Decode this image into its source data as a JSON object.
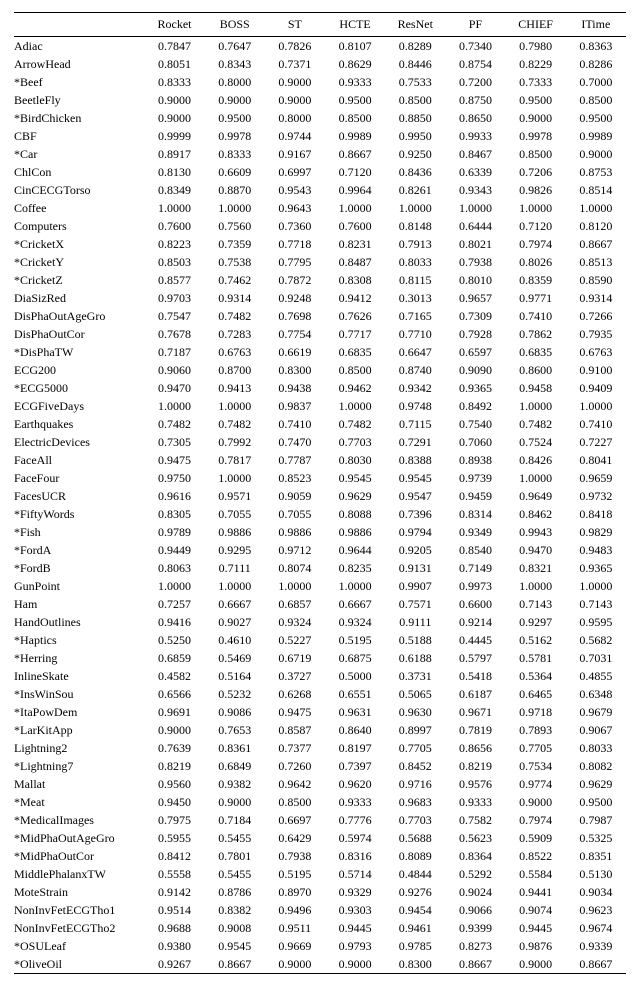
{
  "chart_data": {
    "type": "table",
    "columns": [
      "Rocket",
      "BOSS",
      "ST",
      "HCTE",
      "ResNet",
      "PF",
      "CHIEF",
      "ITime"
    ],
    "rows": [
      {
        "name": "Adiac",
        "v": [
          "0.7847",
          "0.7647",
          "0.7826",
          "0.8107",
          "0.8289",
          "0.7340",
          "0.7980",
          "0.8363"
        ]
      },
      {
        "name": "ArrowHead",
        "v": [
          "0.8051",
          "0.8343",
          "0.7371",
          "0.8629",
          "0.8446",
          "0.8754",
          "0.8229",
          "0.8286"
        ]
      },
      {
        "name": "*Beef",
        "v": [
          "0.8333",
          "0.8000",
          "0.9000",
          "0.9333",
          "0.7533",
          "0.7200",
          "0.7333",
          "0.7000"
        ]
      },
      {
        "name": "BeetleFly",
        "v": [
          "0.9000",
          "0.9000",
          "0.9000",
          "0.9500",
          "0.8500",
          "0.8750",
          "0.9500",
          "0.8500"
        ]
      },
      {
        "name": "*BirdChicken",
        "v": [
          "0.9000",
          "0.9500",
          "0.8000",
          "0.8500",
          "0.8850",
          "0.8650",
          "0.9000",
          "0.9500"
        ]
      },
      {
        "name": "CBF",
        "v": [
          "0.9999",
          "0.9978",
          "0.9744",
          "0.9989",
          "0.9950",
          "0.9933",
          "0.9978",
          "0.9989"
        ]
      },
      {
        "name": "*Car",
        "v": [
          "0.8917",
          "0.8333",
          "0.9167",
          "0.8667",
          "0.9250",
          "0.8467",
          "0.8500",
          "0.9000"
        ]
      },
      {
        "name": "ChlCon",
        "v": [
          "0.8130",
          "0.6609",
          "0.6997",
          "0.7120",
          "0.8436",
          "0.6339",
          "0.7206",
          "0.8753"
        ]
      },
      {
        "name": "CinCECGTorso",
        "v": [
          "0.8349",
          "0.8870",
          "0.9543",
          "0.9964",
          "0.8261",
          "0.9343",
          "0.9826",
          "0.8514"
        ]
      },
      {
        "name": "Coffee",
        "v": [
          "1.0000",
          "1.0000",
          "0.9643",
          "1.0000",
          "1.0000",
          "1.0000",
          "1.0000",
          "1.0000"
        ]
      },
      {
        "name": "Computers",
        "v": [
          "0.7600",
          "0.7560",
          "0.7360",
          "0.7600",
          "0.8148",
          "0.6444",
          "0.7120",
          "0.8120"
        ]
      },
      {
        "name": "*CricketX",
        "v": [
          "0.8223",
          "0.7359",
          "0.7718",
          "0.8231",
          "0.7913",
          "0.8021",
          "0.7974",
          "0.8667"
        ]
      },
      {
        "name": "*CricketY",
        "v": [
          "0.8503",
          "0.7538",
          "0.7795",
          "0.8487",
          "0.8033",
          "0.7938",
          "0.8026",
          "0.8513"
        ]
      },
      {
        "name": "*CricketZ",
        "v": [
          "0.8577",
          "0.7462",
          "0.7872",
          "0.8308",
          "0.8115",
          "0.8010",
          "0.8359",
          "0.8590"
        ]
      },
      {
        "name": "DiaSizRed",
        "v": [
          "0.9703",
          "0.9314",
          "0.9248",
          "0.9412",
          "0.3013",
          "0.9657",
          "0.9771",
          "0.9314"
        ]
      },
      {
        "name": "DisPhaOutAgeGro",
        "v": [
          "0.7547",
          "0.7482",
          "0.7698",
          "0.7626",
          "0.7165",
          "0.7309",
          "0.7410",
          "0.7266"
        ]
      },
      {
        "name": "DisPhaOutCor",
        "v": [
          "0.7678",
          "0.7283",
          "0.7754",
          "0.7717",
          "0.7710",
          "0.7928",
          "0.7862",
          "0.7935"
        ]
      },
      {
        "name": "*DisPhaTW",
        "v": [
          "0.7187",
          "0.6763",
          "0.6619",
          "0.6835",
          "0.6647",
          "0.6597",
          "0.6835",
          "0.6763"
        ]
      },
      {
        "name": "ECG200",
        "v": [
          "0.9060",
          "0.8700",
          "0.8300",
          "0.8500",
          "0.8740",
          "0.9090",
          "0.8600",
          "0.9100"
        ]
      },
      {
        "name": "*ECG5000",
        "v": [
          "0.9470",
          "0.9413",
          "0.9438",
          "0.9462",
          "0.9342",
          "0.9365",
          "0.9458",
          "0.9409"
        ]
      },
      {
        "name": "ECGFiveDays",
        "v": [
          "1.0000",
          "1.0000",
          "0.9837",
          "1.0000",
          "0.9748",
          "0.8492",
          "1.0000",
          "1.0000"
        ]
      },
      {
        "name": "Earthquakes",
        "v": [
          "0.7482",
          "0.7482",
          "0.7410",
          "0.7482",
          "0.7115",
          "0.7540",
          "0.7482",
          "0.7410"
        ]
      },
      {
        "name": "ElectricDevices",
        "v": [
          "0.7305",
          "0.7992",
          "0.7470",
          "0.7703",
          "0.7291",
          "0.7060",
          "0.7524",
          "0.7227"
        ]
      },
      {
        "name": "FaceAll",
        "v": [
          "0.9475",
          "0.7817",
          "0.7787",
          "0.8030",
          "0.8388",
          "0.8938",
          "0.8426",
          "0.8041"
        ]
      },
      {
        "name": "FaceFour",
        "v": [
          "0.9750",
          "1.0000",
          "0.8523",
          "0.9545",
          "0.9545",
          "0.9739",
          "1.0000",
          "0.9659"
        ]
      },
      {
        "name": "FacesUCR",
        "v": [
          "0.9616",
          "0.9571",
          "0.9059",
          "0.9629",
          "0.9547",
          "0.9459",
          "0.9649",
          "0.9732"
        ]
      },
      {
        "name": "*FiftyWords",
        "v": [
          "0.8305",
          "0.7055",
          "0.7055",
          "0.8088",
          "0.7396",
          "0.8314",
          "0.8462",
          "0.8418"
        ]
      },
      {
        "name": "*Fish",
        "v": [
          "0.9789",
          "0.9886",
          "0.9886",
          "0.9886",
          "0.9794",
          "0.9349",
          "0.9943",
          "0.9829"
        ]
      },
      {
        "name": "*FordA",
        "v": [
          "0.9449",
          "0.9295",
          "0.9712",
          "0.9644",
          "0.9205",
          "0.8540",
          "0.9470",
          "0.9483"
        ]
      },
      {
        "name": "*FordB",
        "v": [
          "0.8063",
          "0.7111",
          "0.8074",
          "0.8235",
          "0.9131",
          "0.7149",
          "0.8321",
          "0.9365"
        ]
      },
      {
        "name": "GunPoint",
        "v": [
          "1.0000",
          "1.0000",
          "1.0000",
          "1.0000",
          "0.9907",
          "0.9973",
          "1.0000",
          "1.0000"
        ]
      },
      {
        "name": "Ham",
        "v": [
          "0.7257",
          "0.6667",
          "0.6857",
          "0.6667",
          "0.7571",
          "0.6600",
          "0.7143",
          "0.7143"
        ]
      },
      {
        "name": "HandOutlines",
        "v": [
          "0.9416",
          "0.9027",
          "0.9324",
          "0.9324",
          "0.9111",
          "0.9214",
          "0.9297",
          "0.9595"
        ]
      },
      {
        "name": "*Haptics",
        "v": [
          "0.5250",
          "0.4610",
          "0.5227",
          "0.5195",
          "0.5188",
          "0.4445",
          "0.5162",
          "0.5682"
        ]
      },
      {
        "name": "*Herring",
        "v": [
          "0.6859",
          "0.5469",
          "0.6719",
          "0.6875",
          "0.6188",
          "0.5797",
          "0.5781",
          "0.7031"
        ]
      },
      {
        "name": "InlineSkate",
        "v": [
          "0.4582",
          "0.5164",
          "0.3727",
          "0.5000",
          "0.3731",
          "0.5418",
          "0.5364",
          "0.4855"
        ]
      },
      {
        "name": "*InsWinSou",
        "v": [
          "0.6566",
          "0.5232",
          "0.6268",
          "0.6551",
          "0.5065",
          "0.6187",
          "0.6465",
          "0.6348"
        ]
      },
      {
        "name": "*ItaPowDem",
        "v": [
          "0.9691",
          "0.9086",
          "0.9475",
          "0.9631",
          "0.9630",
          "0.9671",
          "0.9718",
          "0.9679"
        ]
      },
      {
        "name": "*LarKitApp",
        "v": [
          "0.9000",
          "0.7653",
          "0.8587",
          "0.8640",
          "0.8997",
          "0.7819",
          "0.7893",
          "0.9067"
        ]
      },
      {
        "name": "Lightning2",
        "v": [
          "0.7639",
          "0.8361",
          "0.7377",
          "0.8197",
          "0.7705",
          "0.8656",
          "0.7705",
          "0.8033"
        ]
      },
      {
        "name": "*Lightning7",
        "v": [
          "0.8219",
          "0.6849",
          "0.7260",
          "0.7397",
          "0.8452",
          "0.8219",
          "0.7534",
          "0.8082"
        ]
      },
      {
        "name": "Mallat",
        "v": [
          "0.9560",
          "0.9382",
          "0.9642",
          "0.9620",
          "0.9716",
          "0.9576",
          "0.9774",
          "0.9629"
        ]
      },
      {
        "name": "*Meat",
        "v": [
          "0.9450",
          "0.9000",
          "0.8500",
          "0.9333",
          "0.9683",
          "0.9333",
          "0.9000",
          "0.9500"
        ]
      },
      {
        "name": "*MedicalImages",
        "v": [
          "0.7975",
          "0.7184",
          "0.6697",
          "0.7776",
          "0.7703",
          "0.7582",
          "0.7974",
          "0.7987"
        ]
      },
      {
        "name": "*MidPhaOutAgeGro",
        "v": [
          "0.5955",
          "0.5455",
          "0.6429",
          "0.5974",
          "0.5688",
          "0.5623",
          "0.5909",
          "0.5325"
        ]
      },
      {
        "name": "*MidPhaOutCor",
        "v": [
          "0.8412",
          "0.7801",
          "0.7938",
          "0.8316",
          "0.8089",
          "0.8364",
          "0.8522",
          "0.8351"
        ]
      },
      {
        "name": "MiddlePhalanxTW",
        "v": [
          "0.5558",
          "0.5455",
          "0.5195",
          "0.5714",
          "0.4844",
          "0.5292",
          "0.5584",
          "0.5130"
        ]
      },
      {
        "name": "MoteStrain",
        "v": [
          "0.9142",
          "0.8786",
          "0.8970",
          "0.9329",
          "0.9276",
          "0.9024",
          "0.9441",
          "0.9034"
        ]
      },
      {
        "name": "NonInvFetECGTho1",
        "v": [
          "0.9514",
          "0.8382",
          "0.9496",
          "0.9303",
          "0.9454",
          "0.9066",
          "0.9074",
          "0.9623"
        ]
      },
      {
        "name": "NonInvFetECGTho2",
        "v": [
          "0.9688",
          "0.9008",
          "0.9511",
          "0.9445",
          "0.9461",
          "0.9399",
          "0.9445",
          "0.9674"
        ]
      },
      {
        "name": "*OSULeaf",
        "v": [
          "0.9380",
          "0.9545",
          "0.9669",
          "0.9793",
          "0.9785",
          "0.8273",
          "0.9876",
          "0.9339"
        ]
      },
      {
        "name": "*OliveOil",
        "v": [
          "0.9267",
          "0.8667",
          "0.9000",
          "0.9000",
          "0.8300",
          "0.8667",
          "0.9000",
          "0.8667"
        ]
      }
    ]
  }
}
